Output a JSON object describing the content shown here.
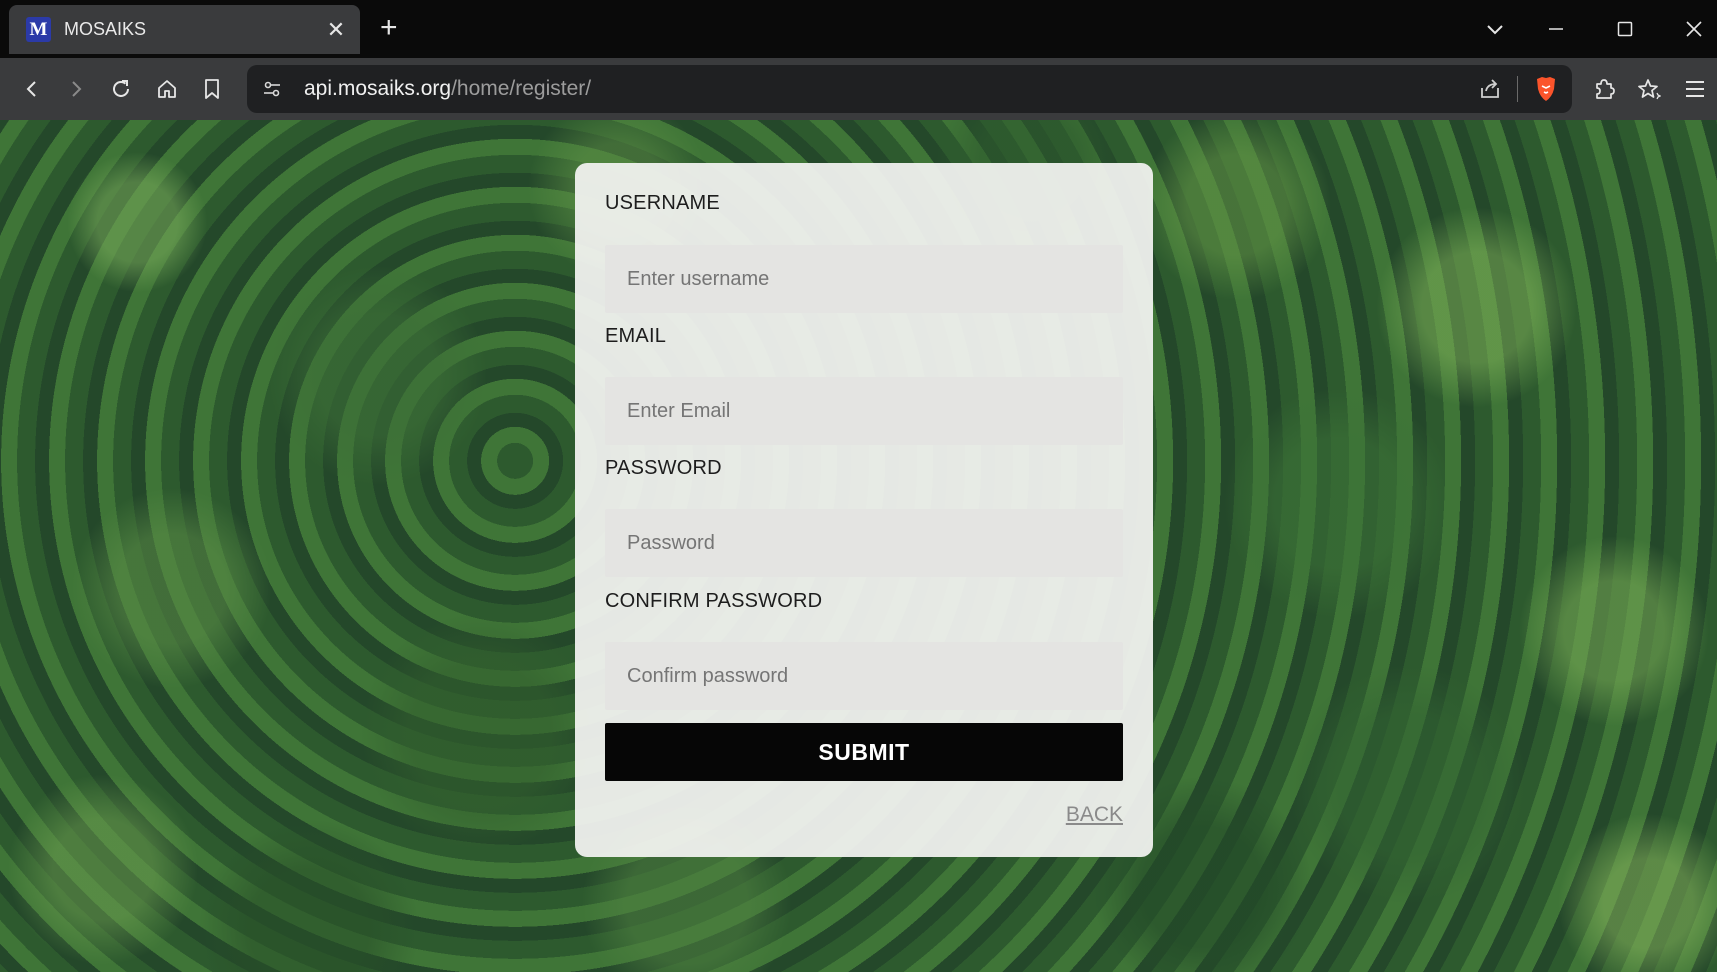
{
  "browser": {
    "tab": {
      "favicon_letter": "M",
      "title": "MOSAIKS"
    },
    "url": {
      "host": "api.mosaiks.org",
      "path": "/home/register/"
    },
    "icons": {
      "tab_close": "close-icon",
      "new_tab": "plus-icon",
      "tab_search": "chevron-down-icon",
      "minimize": "minimize-icon",
      "maximize": "maximize-icon",
      "close_window": "close-window-icon",
      "back": "arrow-left-icon",
      "forward": "arrow-right-icon",
      "reload": "reload-icon",
      "home": "home-icon",
      "bookmark": "bookmark-icon",
      "site_info": "tune-icon",
      "share": "share-icon",
      "brave_shields": "brave-lion-icon",
      "extensions": "puzzle-icon",
      "leo": "sparkle-star-icon",
      "menu": "hamburger-menu-icon"
    }
  },
  "form": {
    "username": {
      "label": "USERNAME",
      "placeholder": "Enter username"
    },
    "email": {
      "label": "EMAIL",
      "placeholder": "Enter Email"
    },
    "password": {
      "label": "PASSWORD",
      "placeholder": "Password"
    },
    "confirm_password": {
      "label": "CONFIRM PASSWORD",
      "placeholder": "Confirm password"
    },
    "submit_label": "SUBMIT",
    "back_label": "BACK"
  },
  "colors": {
    "brand_favicon": "#2b3aa8",
    "brave_orange": "#fb542b",
    "submit_bg": "#060606",
    "card_bg": "#f4f4f2"
  }
}
